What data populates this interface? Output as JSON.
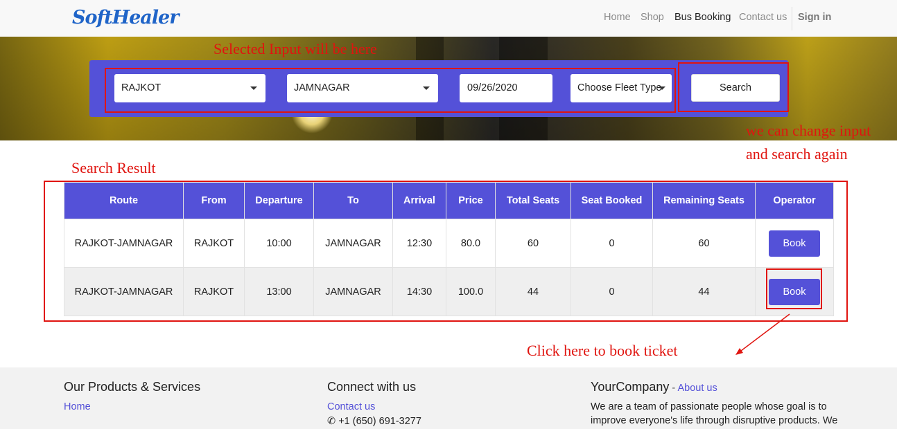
{
  "brand": {
    "logo_text": "SoftHealer"
  },
  "nav": {
    "home": "Home",
    "shop": "Shop",
    "bus_booking": "Bus Booking",
    "contact_us": "Contact us",
    "sign_in": "Sign in"
  },
  "search": {
    "from_value": "RAJKOT",
    "to_value": "JAMNAGAR",
    "date_value": "09/26/2020",
    "fleet_type_value": "Choose Fleet Type",
    "search_label": "Search"
  },
  "annotations": {
    "selected_input": "Selected Input will be here",
    "change_input_line1": "we can change input",
    "change_input_line2": "and search again",
    "search_result": "Search Result",
    "click_to_book": "Click here to book ticket"
  },
  "results": {
    "headers": [
      "Route",
      "From",
      "Departure",
      "To",
      "Arrival",
      "Price",
      "Total Seats",
      "Seat Booked",
      "Remaining Seats",
      "Operator"
    ],
    "rows": [
      {
        "route": "RAJKOT-JAMNAGAR",
        "from": "RAJKOT",
        "departure": "10:00",
        "to": "JAMNAGAR",
        "arrival": "12:30",
        "price": "80.0",
        "total_seats": "60",
        "seat_booked": "0",
        "remaining_seats": "60",
        "action": "Book"
      },
      {
        "route": "RAJKOT-JAMNAGAR",
        "from": "RAJKOT",
        "departure": "13:00",
        "to": "JAMNAGAR",
        "arrival": "14:30",
        "price": "100.0",
        "total_seats": "44",
        "seat_booked": "0",
        "remaining_seats": "44",
        "action": "Book"
      }
    ]
  },
  "footer": {
    "products_title": "Our Products & Services",
    "products_link_home": "Home",
    "connect_title": "Connect with us",
    "connect_contact": "Contact us",
    "connect_phone": "+1 (650) 691-3277",
    "company_title": "YourCompany",
    "company_separator": " - ",
    "company_about": "About us",
    "company_text_line1": "We are a team of passionate people whose goal is to",
    "company_text_line2": "improve everyone's life through disruptive products. We"
  },
  "colors": {
    "accent": "#5451d8",
    "annotation": "#e0140f",
    "logo": "#1f64c8"
  }
}
